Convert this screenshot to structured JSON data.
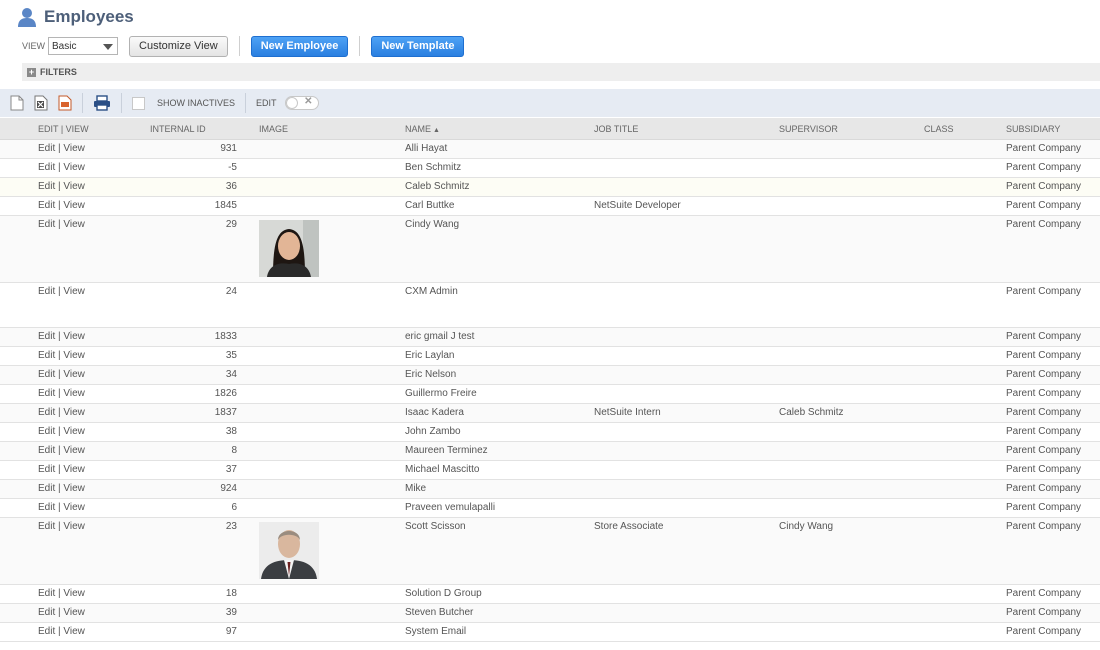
{
  "page": {
    "title": "Employees"
  },
  "controls": {
    "view_label": "VIEW",
    "view_value": "Basic",
    "customize_label": "Customize View",
    "new_employee_label": "New Employee",
    "new_template_label": "New Template"
  },
  "filters": {
    "label": "FILTERS"
  },
  "toolbar": {
    "show_inactives_label": "SHOW INACTIVES",
    "edit_label": "EDIT"
  },
  "columns": [
    "EDIT | VIEW",
    "INTERNAL ID",
    "IMAGE",
    "NAME",
    "JOB TITLE",
    "SUPERVISOR",
    "CLASS",
    "SUBSIDIARY"
  ],
  "rows": [
    {
      "edit": "Edit | View",
      "id": "931",
      "name": "Alli Hayat",
      "job": "",
      "supervisor": "",
      "class": "",
      "subsidiary": "Parent Company"
    },
    {
      "edit": "Edit | View",
      "id": "-5",
      "name": "Ben Schmitz",
      "job": "",
      "supervisor": "",
      "class": "",
      "subsidiary": "Parent Company"
    },
    {
      "edit": "Edit | View",
      "id": "36",
      "name": "Caleb Schmitz",
      "job": "",
      "supervisor": "",
      "class": "",
      "subsidiary": "Parent Company"
    },
    {
      "edit": "Edit | View",
      "id": "1845",
      "name": "Carl Buttke",
      "job": "NetSuite Developer",
      "supervisor": "",
      "class": "",
      "subsidiary": "Parent Company"
    },
    {
      "edit": "Edit | View",
      "id": "29",
      "name": "Cindy Wang",
      "job": "",
      "supervisor": "",
      "class": "",
      "subsidiary": "Parent Company"
    },
    {
      "edit": "Edit | View",
      "id": "24",
      "name": "CXM Admin",
      "job": "",
      "supervisor": "",
      "class": "",
      "subsidiary": "Parent Company"
    },
    {
      "edit": "Edit | View",
      "id": "1833",
      "name": "eric gmail J test",
      "job": "",
      "supervisor": "",
      "class": "",
      "subsidiary": "Parent Company"
    },
    {
      "edit": "Edit | View",
      "id": "35",
      "name": "Eric Laylan",
      "job": "",
      "supervisor": "",
      "class": "",
      "subsidiary": "Parent Company"
    },
    {
      "edit": "Edit | View",
      "id": "34",
      "name": "Eric Nelson",
      "job": "",
      "supervisor": "",
      "class": "",
      "subsidiary": "Parent Company"
    },
    {
      "edit": "Edit | View",
      "id": "1826",
      "name": "Guillermo Freire",
      "job": "",
      "supervisor": "",
      "class": "",
      "subsidiary": "Parent Company"
    },
    {
      "edit": "Edit | View",
      "id": "1837",
      "name": "Isaac Kadera",
      "job": "NetSuite Intern",
      "supervisor": "Caleb Schmitz",
      "class": "",
      "subsidiary": "Parent Company"
    },
    {
      "edit": "Edit | View",
      "id": "38",
      "name": "John Zambo",
      "job": "",
      "supervisor": "",
      "class": "",
      "subsidiary": "Parent Company"
    },
    {
      "edit": "Edit | View",
      "id": "8",
      "name": "Maureen Terminez",
      "job": "",
      "supervisor": "",
      "class": "",
      "subsidiary": "Parent Company"
    },
    {
      "edit": "Edit | View",
      "id": "37",
      "name": "Michael Mascitto",
      "job": "",
      "supervisor": "",
      "class": "",
      "subsidiary": "Parent Company"
    },
    {
      "edit": "Edit | View",
      "id": "924",
      "name": "Mike",
      "job": "",
      "supervisor": "",
      "class": "",
      "subsidiary": "Parent Company"
    },
    {
      "edit": "Edit | View",
      "id": "6",
      "name": "Praveen vemulapalli",
      "job": "",
      "supervisor": "",
      "class": "",
      "subsidiary": "Parent Company"
    },
    {
      "edit": "Edit | View",
      "id": "23",
      "name": "Scott Scisson",
      "job": "Store Associate",
      "supervisor": "Cindy Wang",
      "class": "",
      "subsidiary": "Parent Company"
    },
    {
      "edit": "Edit | View",
      "id": "18",
      "name": "Solution D Group",
      "job": "",
      "supervisor": "",
      "class": "",
      "subsidiary": "Parent Company"
    },
    {
      "edit": "Edit | View",
      "id": "39",
      "name": "Steven Butcher",
      "job": "",
      "supervisor": "",
      "class": "",
      "subsidiary": "Parent Company"
    },
    {
      "edit": "Edit | View",
      "id": "97",
      "name": "System Email",
      "job": "",
      "supervisor": "",
      "class": "",
      "subsidiary": "Parent Company"
    }
  ],
  "colors": {
    "accent": "#2a7fe0",
    "title": "#4d5f79",
    "toolbar_bg": "#e6ebf3"
  }
}
